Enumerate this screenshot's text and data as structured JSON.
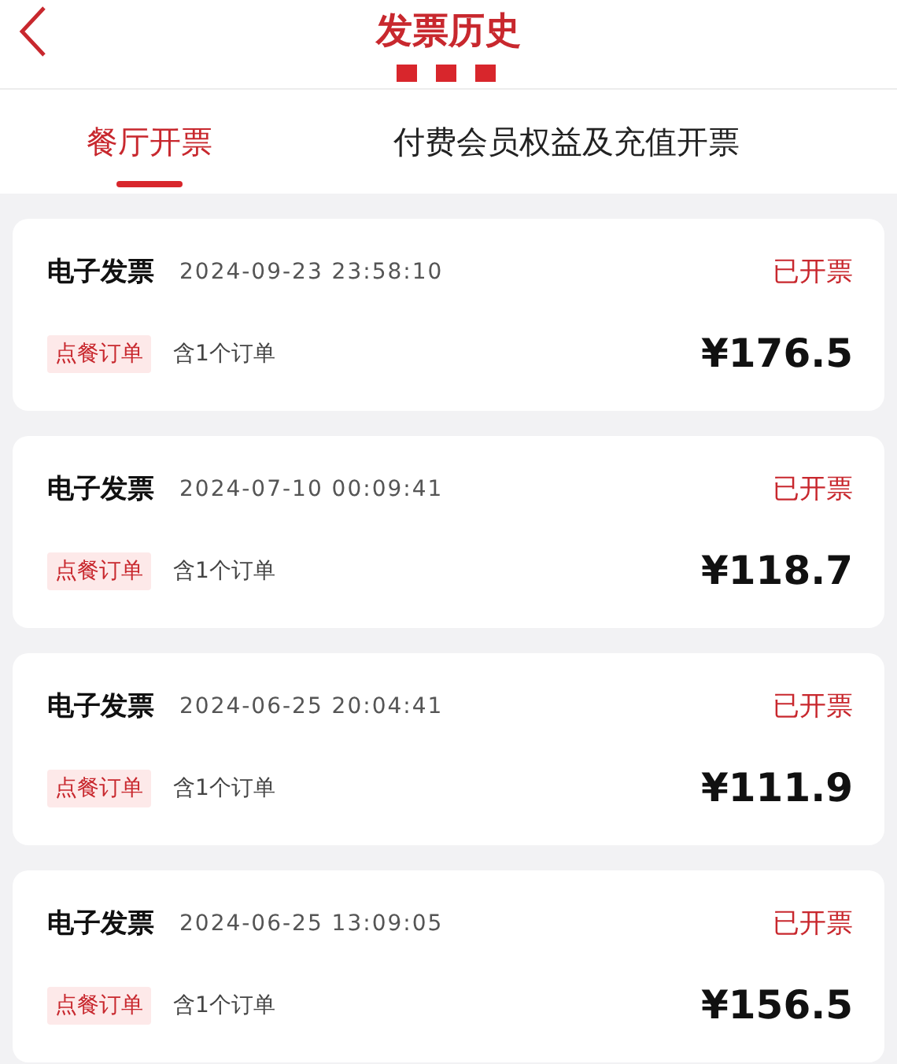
{
  "header": {
    "title": "发票历史"
  },
  "tabs": [
    {
      "label": "餐厅开票",
      "selected": true
    },
    {
      "label": "付费会员权益及充值开票",
      "selected": false
    }
  ],
  "invoices": [
    {
      "type": "电子发票",
      "time": "2024-09-23 23:58:10",
      "status": "已开票",
      "tag": "点餐订单",
      "orders": "含1个订单",
      "amount": "¥176.5"
    },
    {
      "type": "电子发票",
      "time": "2024-07-10 00:09:41",
      "status": "已开票",
      "tag": "点餐订单",
      "orders": "含1个订单",
      "amount": "¥118.7"
    },
    {
      "type": "电子发票",
      "time": "2024-06-25 20:04:41",
      "status": "已开票",
      "tag": "点餐订单",
      "orders": "含1个订单",
      "amount": "¥111.9"
    },
    {
      "type": "电子发票",
      "time": "2024-06-25 13:09:05",
      "status": "已开票",
      "tag": "点餐订单",
      "orders": "含1个订单",
      "amount": "¥156.5"
    }
  ]
}
